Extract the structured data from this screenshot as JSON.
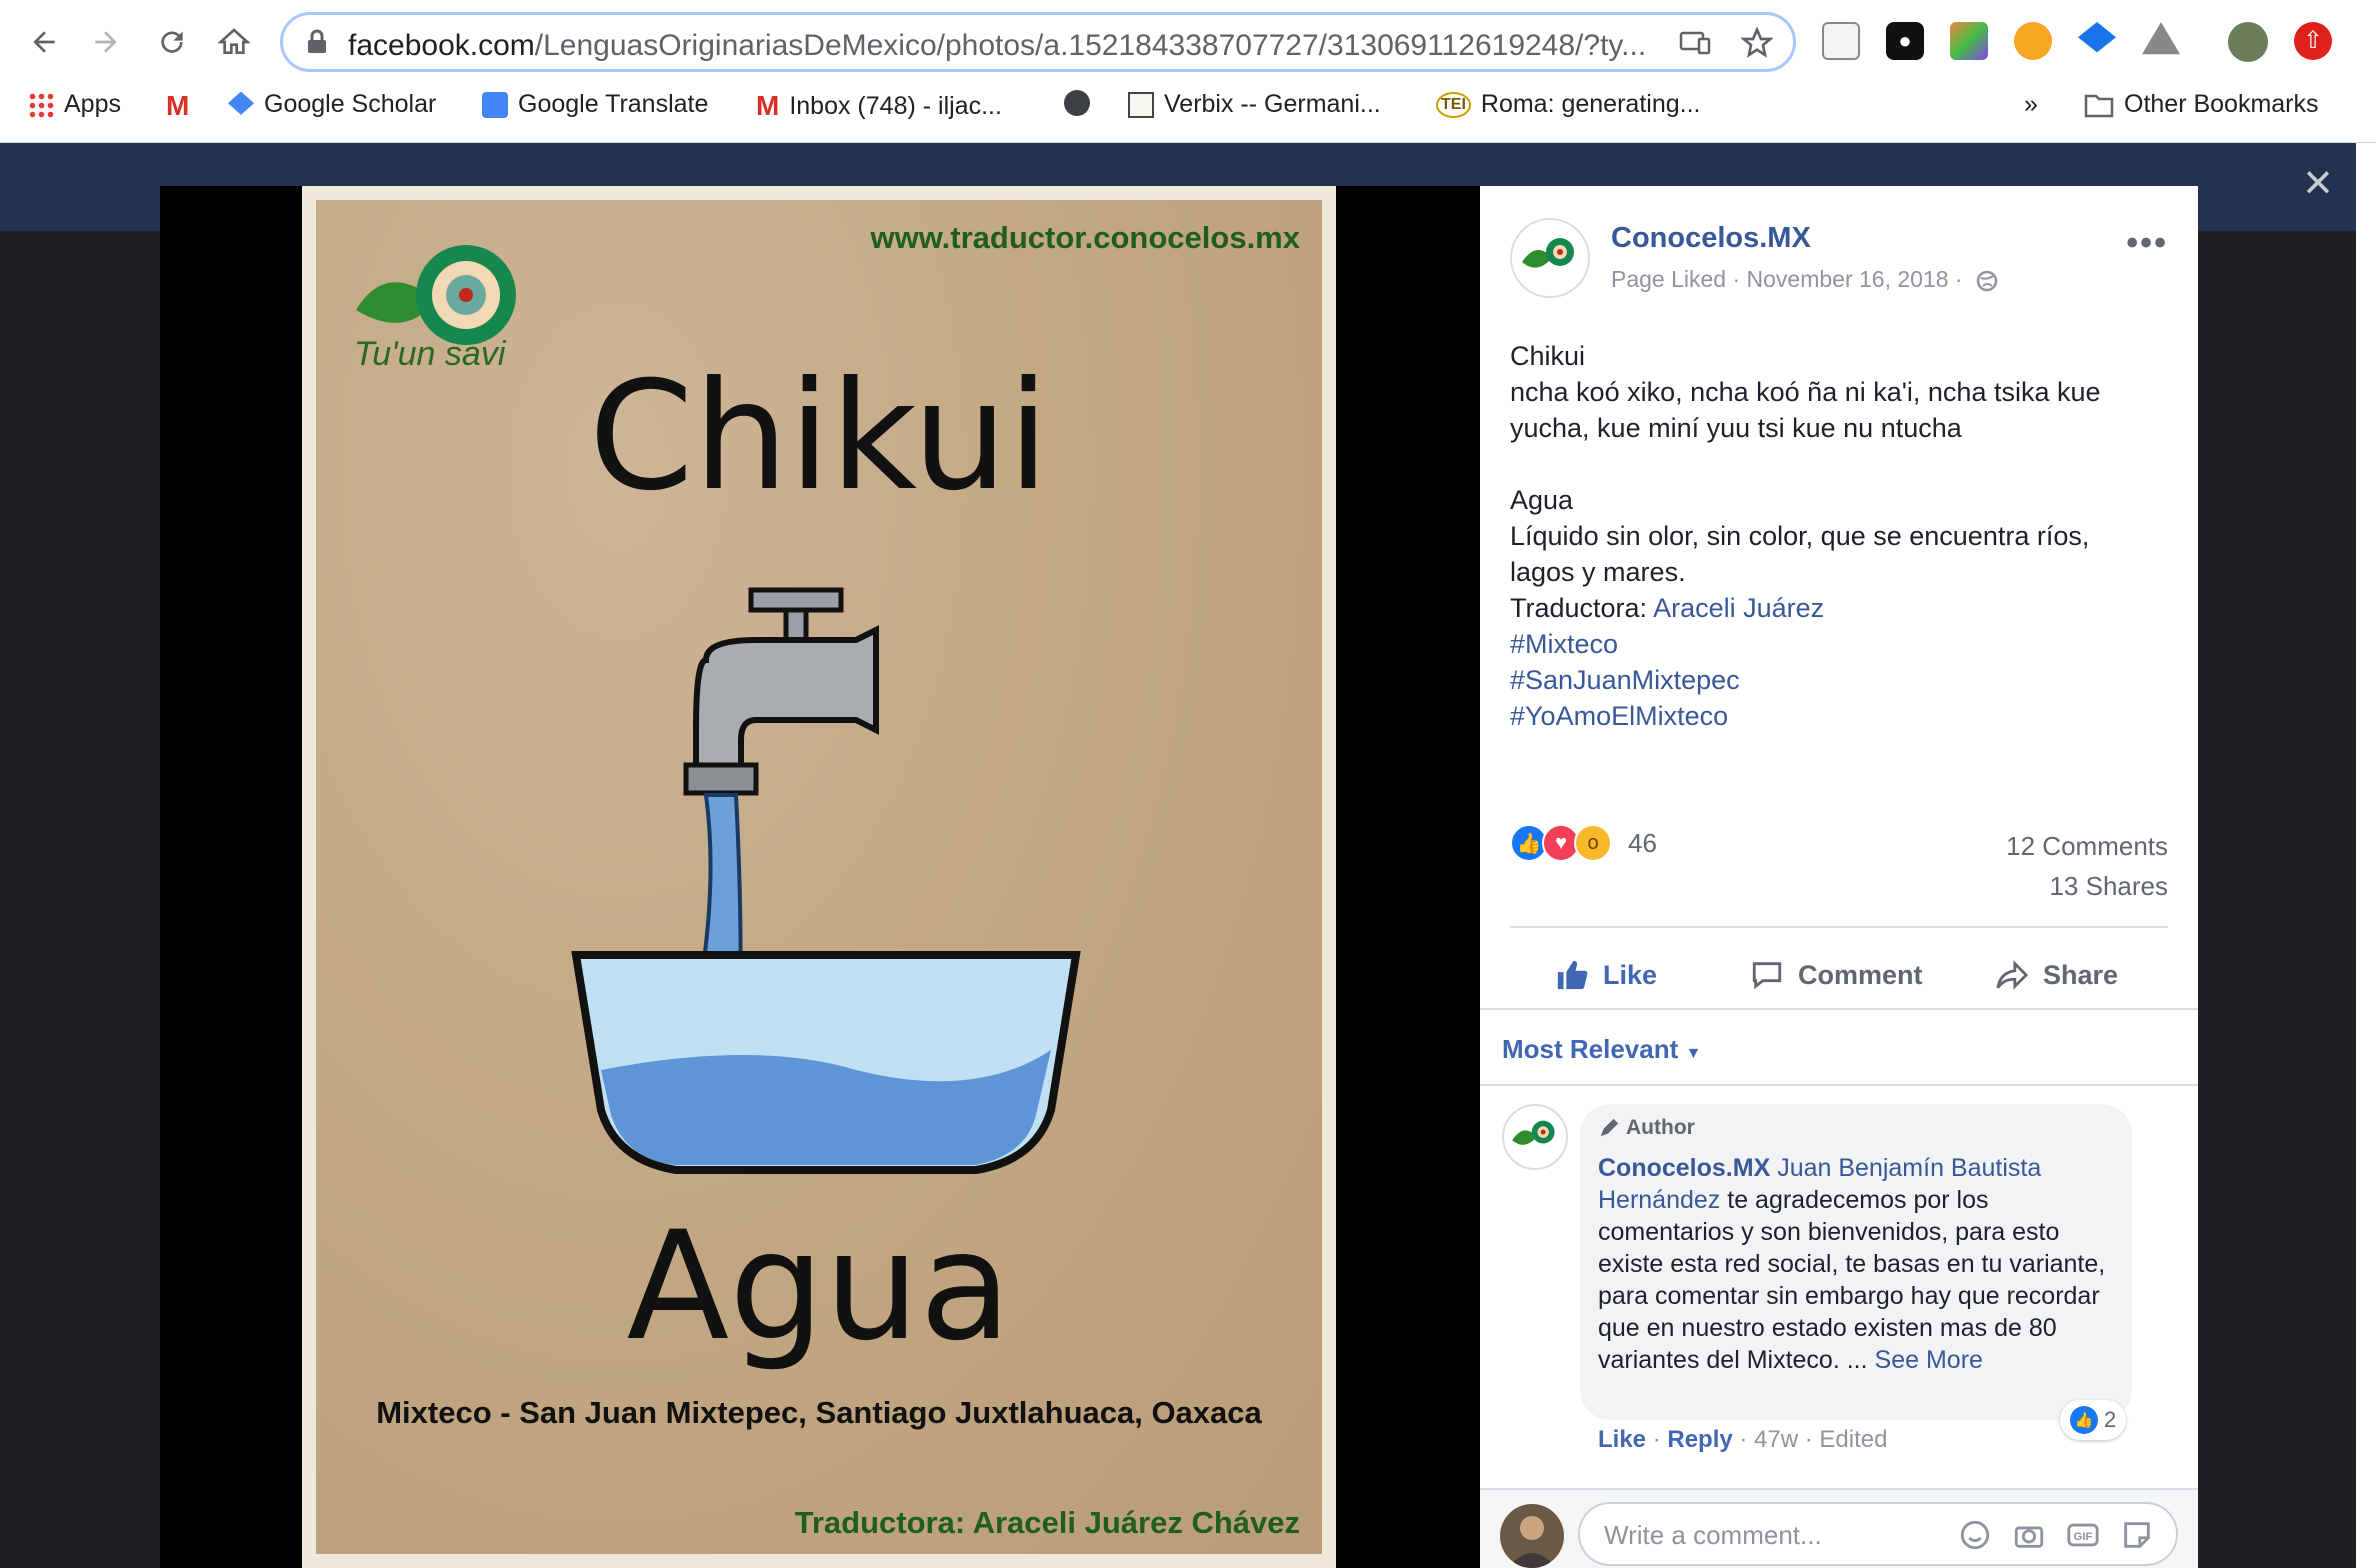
{
  "browser": {
    "url_domain": "facebook.com",
    "url_path": "/LenguasOriginariasDeMexico/photos/a.152184338707727/313069112619248/?ty...",
    "bookmarks": [
      {
        "label": "Apps",
        "icon": "apps-grid-icon"
      },
      {
        "label": "",
        "icon": "gmail-icon"
      },
      {
        "label": "Google Scholar",
        "icon": "scholar-cap-icon"
      },
      {
        "label": "Google Translate",
        "icon": "translate-icon"
      },
      {
        "label": "Inbox (748) - iljac...",
        "icon": "gmail-icon"
      },
      {
        "label": "",
        "icon": "globe-icon"
      },
      {
        "label": "Verbix -- Germani...",
        "icon": "book-icon"
      },
      {
        "label": "Roma: generating...",
        "icon": "tei-icon"
      }
    ],
    "overflow": "»",
    "other_bookmarks": "Other Bookmarks"
  },
  "photo": {
    "url": "www.traductor.conocelos.mx",
    "logo_text": "Tu'un savi",
    "word": "Chikui",
    "translation": "Agua",
    "region": "Mixteco - San Juan Mixtepec, Santiago Juxtlahuaca, Oaxaca",
    "credit": "Traductora: Araceli Juárez Chávez"
  },
  "post": {
    "page_name": "Conocelos.MX",
    "meta": "Page Liked · November 16, 2018 ·",
    "lines": [
      "Chikui",
      "ncha koó xiko, ncha koó ña ni ka'i, ncha tsika kue",
      "yucha, kue miní yuu tsi kue nu ntucha",
      "",
      "Agua",
      "Líquido sin olor, sin color, que se encuentra ríos,",
      "lagos y mares."
    ],
    "translator_label": "Traductora: ",
    "translator_link": "Araceli Juárez",
    "hashtags": [
      "#Mixteco",
      "#SanJuanMixtepec",
      "#YoAmoElMixteco"
    ],
    "reactions_count": "46",
    "comments": "12 Comments",
    "shares": "13 Shares",
    "actions": {
      "like": "Like",
      "comment": "Comment",
      "share": "Share"
    },
    "sort": "Most Relevant"
  },
  "comment": {
    "author_tag": "Author",
    "author": "Conocelos.MX",
    "mention": "Juan Benjamín Bautista Hernández",
    "text": " te agradecemos por los comentarios y son bienvenidos, para esto existe esta red social, te basas en tu variante, para comentar sin embargo hay que recordar que en nuestro estado existen mas de 80 variantes del Mixteco.",
    "ellipsis": "... ",
    "see_more": "See More",
    "like": "Like",
    "reply": "Reply",
    "meta": "· 47w · Edited",
    "like_count": "2"
  },
  "compose": {
    "placeholder": "Write a comment..."
  },
  "colors": {
    "fb_link": "#385898",
    "fb_blue": "#4267b2"
  }
}
